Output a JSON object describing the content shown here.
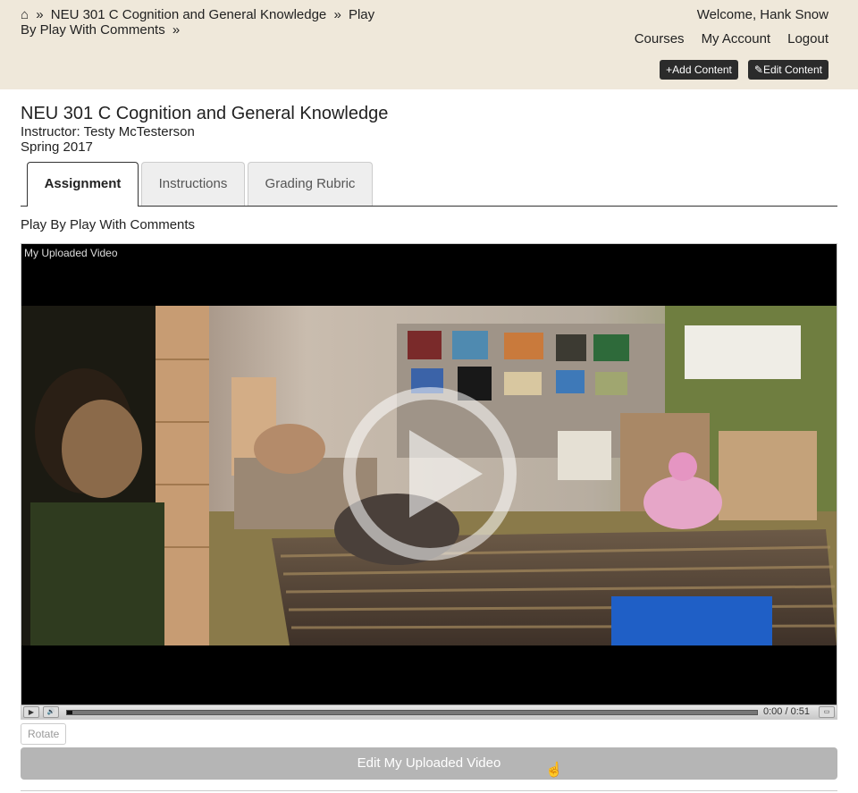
{
  "header": {
    "breadcrumb": {
      "home_icon": "home-icon",
      "home_glyph": "⌂",
      "separator": "»",
      "items": [
        "NEU 301 C Cognition and General Knowledge",
        "Play By Play With Comments"
      ]
    },
    "welcome": "Welcome, Hank Snow",
    "nav": [
      "Courses",
      "My Account",
      "Logout"
    ],
    "buttons": {
      "add_content": "+Add Content",
      "edit_content": "✎Edit Content"
    }
  },
  "course": {
    "title": "NEU 301 C Cognition and General Knowledge",
    "instructor": "Instructor: Testy McTesterson",
    "term": "Spring 2017"
  },
  "tabs": [
    {
      "label": "Assignment",
      "active": true
    },
    {
      "label": "Instructions",
      "active": false
    },
    {
      "label": "Grading Rubric",
      "active": false
    }
  ],
  "assignment": {
    "name": "Play By Play With Comments"
  },
  "player": {
    "video_title": "My Uploaded Video",
    "play_glyph": "▶",
    "volume_glyph": "🔊",
    "current_time": "0:00",
    "time_separator": "/",
    "duration": "0:51",
    "progress": 0.0
  },
  "actions": {
    "rotate": "Rotate",
    "edit_video": "Edit My Uploaded Video"
  },
  "colors": {
    "header_bg": "#efe8da",
    "admin_button_bg": "#2b2b2b",
    "edit_video_button_bg": "#b5b5b5"
  }
}
